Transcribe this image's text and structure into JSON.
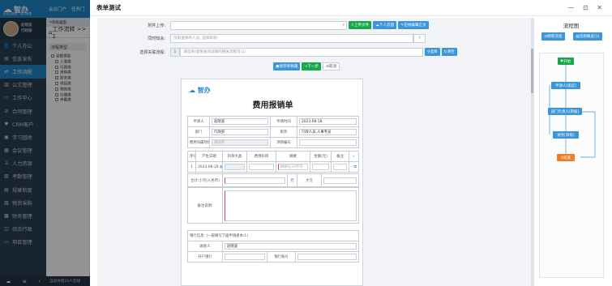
{
  "app": {
    "title": "智办",
    "subtitle": "企业云数据 · 协同管理",
    "user_name": "赵晓波",
    "user_dept": "行政部",
    "top_tabs": [
      "会议门户",
      "任务门"
    ],
    "footer_text": "当前共有24人在线"
  },
  "sidebar": {
    "items": [
      {
        "icon": "person-icon",
        "glyph": "👤",
        "label": "个人办公"
      },
      {
        "icon": "news-icon",
        "glyph": "▤",
        "label": "信息发布"
      },
      {
        "icon": "workflow-icon",
        "glyph": "⇄",
        "label": "工作流程"
      },
      {
        "icon": "doc-icon",
        "glyph": "▥",
        "label": "公文管理"
      },
      {
        "icon": "monitor-icon",
        "glyph": "▭",
        "label": "工作中心"
      },
      {
        "icon": "contract-icon",
        "glyph": "⊘",
        "label": "合同管理"
      },
      {
        "icon": "crm-icon",
        "glyph": "♥",
        "label": "CRM客户"
      },
      {
        "icon": "book-icon",
        "glyph": "▣",
        "label": "学习园地"
      },
      {
        "icon": "meeting-icon",
        "glyph": "▦",
        "label": "会议管理"
      },
      {
        "icon": "hr-icon",
        "glyph": "♙",
        "label": "人力资源"
      },
      {
        "icon": "exam-icon",
        "glyph": "▧",
        "label": "考勤管理"
      },
      {
        "icon": "rules-icon",
        "glyph": "▤",
        "label": "规章制度"
      },
      {
        "icon": "purchase-icon",
        "glyph": "▨",
        "label": "物资采购"
      },
      {
        "icon": "finance-icon",
        "glyph": "▩",
        "label": "财务管理"
      },
      {
        "icon": "admin-icon",
        "glyph": "◫",
        "label": "综合行政"
      },
      {
        "icon": "project-icon",
        "glyph": "▭",
        "label": "项目管理"
      }
    ]
  },
  "panel2": {
    "tabs_text": "系统桌面",
    "title": "工作流转 >> 1",
    "section": "流程类型",
    "tree_root": "全部类型",
    "tree_children": [
      "人事类",
      "行政类",
      "采购类",
      "财务类",
      "项目类",
      "物资类",
      "仪器类",
      "考勤类"
    ]
  },
  "modal": {
    "title": "表单测试",
    "window_controls": "—  ⊡  ✕",
    "attachment_label": "附件上传:",
    "upload_file": "上传文件",
    "personal_cloud": "个人云盘",
    "online_edit": "在线编辑正文",
    "cc_label": "同时知会:",
    "cc_placeholder": "仅限查阅的人员, 选择知会!",
    "related_label": "选择关联流程:",
    "related_count": "1",
    "related_placeholder": "请选择(能够查阅选择的相关流程可以)",
    "select_btn": "选择",
    "reset_btn": "清空",
    "save_draft": "保存草稿箱",
    "next_step": "下一步",
    "cancel": "取消"
  },
  "doc": {
    "brand": "智办",
    "title": "费用报销单",
    "applicant_label": "申请人",
    "applicant": "赵晓波",
    "apply_time_label": "申请时间",
    "apply_time": "2023-08-18",
    "dept_label": "部门",
    "dept": "行政部",
    "position_label": "职务",
    "position": "行政人员,人事专员",
    "expense_project_label": "费用归属项目",
    "expense_project_ph": "请选择",
    "project_no_label": "项目编号",
    "detail_headers": [
      "序号",
      "产生日期",
      "科目大类",
      "费用科目",
      "摘要",
      "金额(元)",
      "备注",
      "+"
    ],
    "detail_row": {
      "no": "1",
      "date": "2023-08-18",
      "summary_ph": "摘要在20字内"
    },
    "total_label": "合计:小写(人民币)",
    "yuan": "元",
    "upper_label": "大写",
    "remark_label": "备注说明:",
    "bank_title": "银行信息: (一般填写下面申请者本人)",
    "payee_label": "收款人",
    "payee": "赵晓波",
    "bank_label": "开户银行",
    "account_label": "银行账号"
  },
  "flow": {
    "title": "流程图",
    "btn_refresh": "刷新流程",
    "btn_overview": "流程概览(1)",
    "nodes": [
      "开始",
      "申请人[发起]",
      "部门负责人[审核]",
      "财务[审核]",
      "结束"
    ]
  }
}
